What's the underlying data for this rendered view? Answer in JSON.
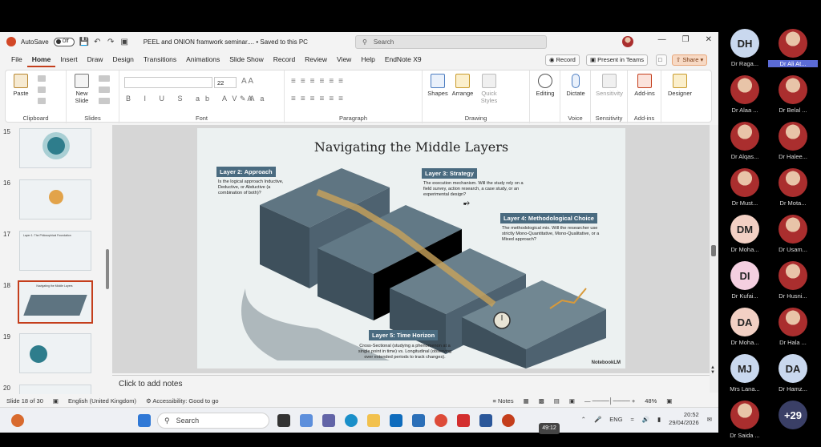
{
  "titlebar": {
    "autosave_label": "AutoSave",
    "autosave_state": "Off",
    "doc_title": "PEEL and ONION framwork seminar.... • Saved to this PC",
    "search_placeholder": "Search"
  },
  "menu": {
    "tabs": [
      "File",
      "Home",
      "Insert",
      "Draw",
      "Design",
      "Transitions",
      "Animations",
      "Slide Show",
      "Record",
      "Review",
      "View",
      "Help",
      "EndNote X9"
    ],
    "active": "Home",
    "record_btn": "Record",
    "present_btn": "Present in Teams",
    "share_btn": "Share"
  },
  "ribbon": {
    "clipboard": {
      "label": "Clipboard",
      "paste": "Paste"
    },
    "slides": {
      "label": "Slides",
      "new_slide": "New Slide"
    },
    "font": {
      "label": "Font",
      "size": "22"
    },
    "paragraph": {
      "label": "Paragraph"
    },
    "drawing": {
      "label": "Drawing",
      "shapes": "Shapes",
      "arrange": "Arrange",
      "quick_styles": "Quick Styles"
    },
    "editing": {
      "label": "Editing"
    },
    "voice": {
      "label": "Voice",
      "dictate": "Dictate"
    },
    "sensitivity": {
      "label": "Sensitivity",
      "btn": "Sensitivity"
    },
    "addins": {
      "label": "Add-ins",
      "btn": "Add-ins"
    },
    "designer": {
      "btn": "Designer"
    }
  },
  "thumbnails": [
    {
      "num": "15",
      "text": ""
    },
    {
      "num": "16",
      "text": ""
    },
    {
      "num": "17",
      "text": "Layer 1: The Philosophical Foundation"
    },
    {
      "num": "18",
      "text": "Navigating the Middle Layers"
    },
    {
      "num": "19",
      "text": ""
    },
    {
      "num": "20",
      "text": ""
    }
  ],
  "slide": {
    "title": "Navigating the Middle Layers",
    "layer2": {
      "label": "Layer 2: Approach",
      "text": "Is the logical approach Inductive, Deductive, or Abductive (a combination of both)?"
    },
    "layer3": {
      "label": "Layer 3: Strategy",
      "text": "The execution mechanism. Will the study rely on a field survey, action research, a case study, or an experimental design?"
    },
    "layer4": {
      "label": "Layer 4: Methodological Choice",
      "text": "The methodological mix. Will the researcher use strictly Mono-Quantitative, Mono-Qualitative, or a Mixed approach?"
    },
    "layer5": {
      "label": "Layer 5: Time Horizon",
      "text": "Cross-Sectional (studying a phenomenon at a single point in time) vs. Longitudinal (observing over extended periods to track changes)."
    },
    "watermark": "NotebookLM"
  },
  "notes_placeholder": "Click to add notes",
  "status": {
    "slide_of": "Slide 18 of 30",
    "language": "English (United Kingdom)",
    "accessibility": "Accessibility: Good to go",
    "notes": "Notes",
    "zoom": "48%"
  },
  "taskbar": {
    "search": "Search",
    "lang": "ENG",
    "time": "20:52",
    "date": "29/04/2026",
    "timer": "49:12"
  },
  "participants": [
    {
      "initials": "DH",
      "name": "Dr Raga...",
      "color": "#c9d8ee",
      "photo": false,
      "highlight": false
    },
    {
      "initials": "",
      "name": "Dr Ali At...",
      "color": "",
      "photo": true,
      "highlight": true
    },
    {
      "initials": "",
      "name": "Dr Alaa ...",
      "color": "",
      "photo": true,
      "highlight": false
    },
    {
      "initials": "",
      "name": "Dr Belal ...",
      "color": "",
      "photo": true,
      "highlight": false
    },
    {
      "initials": "",
      "name": "Dr Alqas...",
      "color": "",
      "photo": true,
      "highlight": false
    },
    {
      "initials": "",
      "name": "Dr Halee...",
      "color": "",
      "photo": true,
      "highlight": false
    },
    {
      "initials": "",
      "name": "Dr Must...",
      "color": "",
      "photo": true,
      "highlight": false
    },
    {
      "initials": "",
      "name": "Dr Mota...",
      "color": "",
      "photo": true,
      "highlight": false
    },
    {
      "initials": "DM",
      "name": "Dr Moha...",
      "color": "#f2d0c4",
      "photo": false,
      "highlight": false
    },
    {
      "initials": "",
      "name": "Dr Usam...",
      "color": "",
      "photo": true,
      "highlight": false
    },
    {
      "initials": "DI",
      "name": "Dr Kufai...",
      "color": "#f4cfe0",
      "photo": false,
      "highlight": false
    },
    {
      "initials": "",
      "name": "Dr Husni...",
      "color": "",
      "photo": true,
      "highlight": false
    },
    {
      "initials": "DA",
      "name": "Dr Moha...",
      "color": "#f2d0c4",
      "photo": false,
      "highlight": false
    },
    {
      "initials": "",
      "name": "Dr Hala ...",
      "color": "",
      "photo": true,
      "highlight": false
    },
    {
      "initials": "MJ",
      "name": "Mrs Lana...",
      "color": "#c9d8ee",
      "photo": false,
      "highlight": false
    },
    {
      "initials": "DA",
      "name": "Dr Hamz...",
      "color": "#c9d8ee",
      "photo": false,
      "highlight": false
    },
    {
      "initials": "",
      "name": "Dr Saida ...",
      "color": "",
      "photo": true,
      "highlight": false
    },
    {
      "initials": "+29",
      "name": "",
      "color": "#3a3f66",
      "photo": false,
      "highlight": false
    }
  ]
}
